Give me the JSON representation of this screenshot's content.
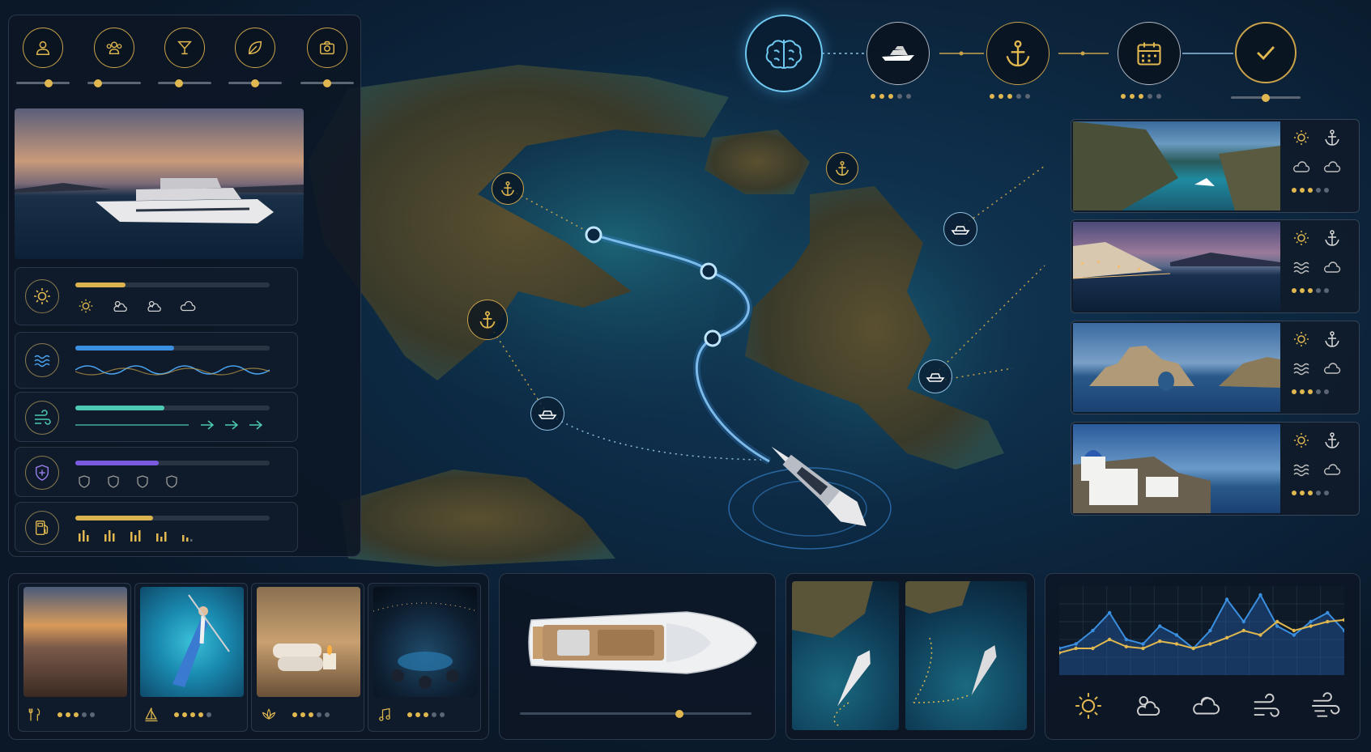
{
  "colors": {
    "accent_gold": "#e0b84f",
    "accent_blue": "#3a8fe0",
    "accent_teal": "#4cc9b0",
    "accent_purple": "#7a5be0",
    "panel_bg": "#101b2a",
    "sea": "#0c2740"
  },
  "preferences": {
    "icons": [
      "user-icon",
      "group-icon",
      "cocktail-icon",
      "leaf-icon",
      "camera-icon"
    ],
    "levels": [
      0.6,
      0.2,
      0.4,
      0.5,
      0.5
    ]
  },
  "metrics": [
    {
      "icon": "sun-icon",
      "fill": 0.26,
      "color": "#d9b34f",
      "sub_icons": [
        "sun-icon",
        "partly-cloudy-icon",
        "partly-cloudy-icon",
        "cloud-icon"
      ]
    },
    {
      "icon": "waves-icon",
      "fill": 0.51,
      "color": "#3a8fe0",
      "sub_icons": [
        "wave-line-icon"
      ]
    },
    {
      "icon": "wind-icon",
      "fill": 0.46,
      "color": "#4cc9b0",
      "sub_icons": [
        "arrow-right-icon",
        "arrow-right-icon",
        "arrow-right-icon"
      ]
    },
    {
      "icon": "shield-icon",
      "fill": 0.43,
      "color": "#7a5be0",
      "sub_icons": [
        "shield-small-icon",
        "shield-small-icon",
        "shield-small-icon",
        "shield-small-icon"
      ]
    },
    {
      "icon": "fuel-icon",
      "fill": 0.4,
      "color": "#d9b34f",
      "sub_icons": [
        "signal-bars-icon"
      ]
    }
  ],
  "workflow": {
    "steps": [
      "brain-icon",
      "yacht-icon",
      "anchor-icon",
      "calendar-icon",
      "check-icon"
    ],
    "ratings": [
      3,
      3,
      3,
      3
    ],
    "final_progress": 0.5
  },
  "destinations": [
    {
      "name": "cove",
      "rating": 3,
      "icons": [
        "sun-icon",
        "anchor-icon",
        "cloud-icon",
        "cloud-icon"
      ]
    },
    {
      "name": "harbor-town",
      "rating": 3,
      "icons": [
        "sun-icon",
        "anchor-icon",
        "waves-icon",
        "cloud-icon"
      ]
    },
    {
      "name": "rock-arch",
      "rating": 3,
      "icons": [
        "sun-icon",
        "anchor-icon",
        "waves-icon",
        "cloud-icon"
      ]
    },
    {
      "name": "white-village",
      "rating": 3,
      "icons": [
        "sun-icon",
        "anchor-icon",
        "waves-icon",
        "cloud-icon"
      ]
    }
  ],
  "experiences": [
    {
      "name": "dining",
      "icon": "dining-icon",
      "rating": 3
    },
    {
      "name": "paddleboard",
      "icon": "sail-icon",
      "rating": 4
    },
    {
      "name": "spa",
      "icon": "lotus-icon",
      "rating": 3
    },
    {
      "name": "night-party",
      "icon": "music-icon",
      "rating": 3
    }
  ],
  "yacht_layout": {
    "timeline_progress": 0.69
  },
  "weather_forecast": {
    "icons": [
      "sun-icon",
      "partly-cloudy-icon",
      "cloudy-icon",
      "wind-icon",
      "storm-wind-icon"
    ]
  },
  "chart_data": {
    "type": "area",
    "series": [
      {
        "values": [
          0.3,
          0.35,
          0.5,
          0.7,
          0.4,
          0.35,
          0.55,
          0.45,
          0.3,
          0.5,
          0.85,
          0.6,
          0.9,
          0.55,
          0.45,
          0.6,
          0.7,
          0.5
        ]
      },
      {
        "values": [
          0.25,
          0.3,
          0.3,
          0.4,
          0.32,
          0.3,
          0.38,
          0.35,
          0.3,
          0.35,
          0.42,
          0.5,
          0.45,
          0.6,
          0.5,
          0.55,
          0.6,
          0.62
        ]
      }
    ],
    "ylim": [
      0,
      1
    ],
    "grid": true
  }
}
